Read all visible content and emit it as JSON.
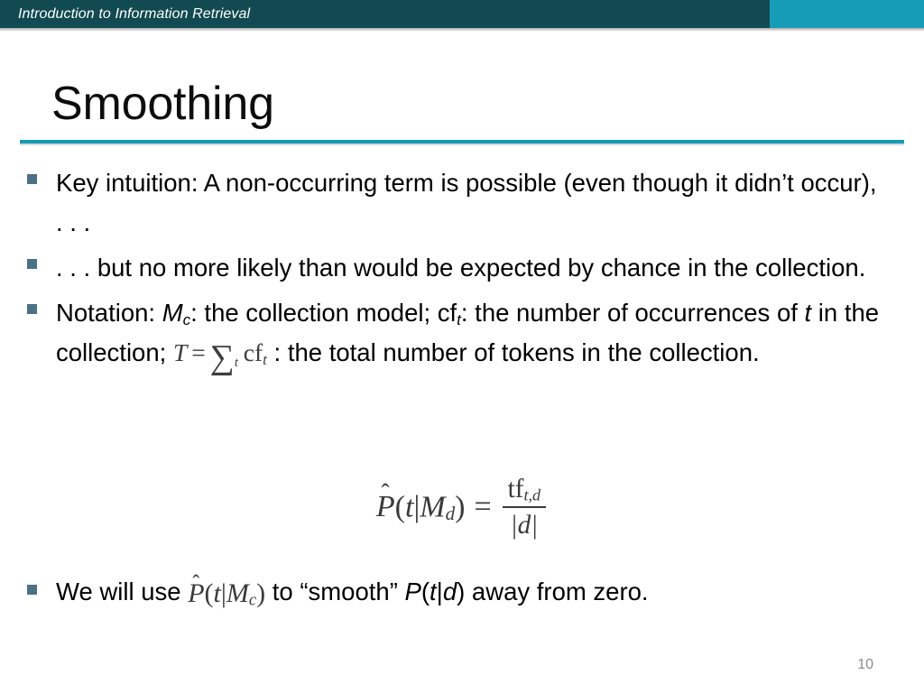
{
  "header": {
    "title": "Introduction to Information Retrieval",
    "left_color": "#124a51",
    "right_color": "#179cb8"
  },
  "slide": {
    "title": "Smoothing",
    "rule_color": "#169cb4",
    "page_number": "10",
    "bullet_color": "#4a7186"
  },
  "bullets": [
    {
      "id": "key-intuition",
      "part1": "Key intuition: A non-occurring term is possible (even though it didn’t occur), . . ."
    },
    {
      "id": "no-more-likely",
      "part1": " . . . but no more likely than would be expected by chance in the collection."
    },
    {
      "id": "notation",
      "pre": "Notation: ",
      "sym_M": "M",
      "sym_M_sub": "c",
      "mid1": ": the collection model; cf",
      "sym_cf_sub": "t",
      "mid2": ": the number of occurrences of ",
      "sym_t": "t",
      "mid3": " in the collection; ",
      "math_T": "T",
      "math_eq": "=",
      "math_sum": "∑",
      "math_sum_sub": "t",
      "math_cf": "cf",
      "math_cf_sub": "t",
      "post": " : the total number of tokens in the collection."
    }
  ],
  "display_equation": {
    "hat": "ˆ",
    "p": "P",
    "open": "(",
    "t": "t",
    "bar": "|",
    "m": "M",
    "m_sub": "d",
    "close": ")",
    "equals": "=",
    "numerator_rm": "tf",
    "numerator_sub": "t,d",
    "denominator": "|d|"
  },
  "last_bullet": {
    "pre": "We will use ",
    "eq_hat": "ˆ",
    "eq_p": "P",
    "eq_open": "(",
    "eq_t": "t",
    "eq_bar": "|",
    "eq_m": "M",
    "eq_m_sub": "c",
    "eq_close": ")",
    "mid": " to “smooth” ",
    "p2": "P",
    "p2_open": "(",
    "p2_t": "t",
    "p2_bar": "|",
    "p2_d": "d",
    "p2_close": ")",
    "post": " away from zero."
  }
}
